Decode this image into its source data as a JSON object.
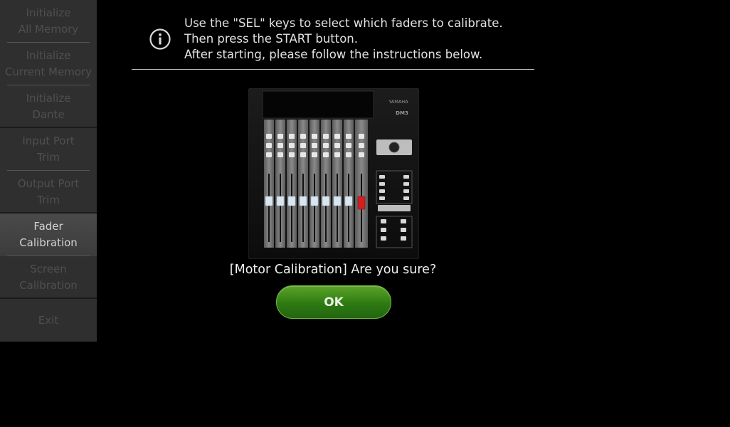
{
  "sidebar": {
    "items": [
      {
        "label": "Initialize\nAll Memory",
        "active": false
      },
      {
        "label": "Initialize\nCurrent Memory",
        "active": false
      },
      {
        "label": "Initialize\nDante",
        "active": false
      },
      {
        "label": "Input Port\nTrim",
        "active": false
      },
      {
        "label": "Output Port\nTrim",
        "active": false
      },
      {
        "label": "Fader\nCalibration",
        "active": true
      },
      {
        "label": "Screen\nCalibration",
        "active": false
      },
      {
        "label": "Exit",
        "active": false
      }
    ]
  },
  "instructions": {
    "icon": "info-icon",
    "line1": "Use the \"SEL\" keys to select which faders to calibrate.",
    "line2": "Then press the START button.",
    "line3": "After starting, please follow the instructions below."
  },
  "console": {
    "brand": "YAMAHA",
    "model": "DM3"
  },
  "dialog": {
    "question": "[Motor Calibration] Are you sure?",
    "ok_label": "OK"
  },
  "colors": {
    "ok_green": "#2e7a12",
    "active_fader": "#d02020",
    "sidebar_bg": "#2f2f2f"
  }
}
